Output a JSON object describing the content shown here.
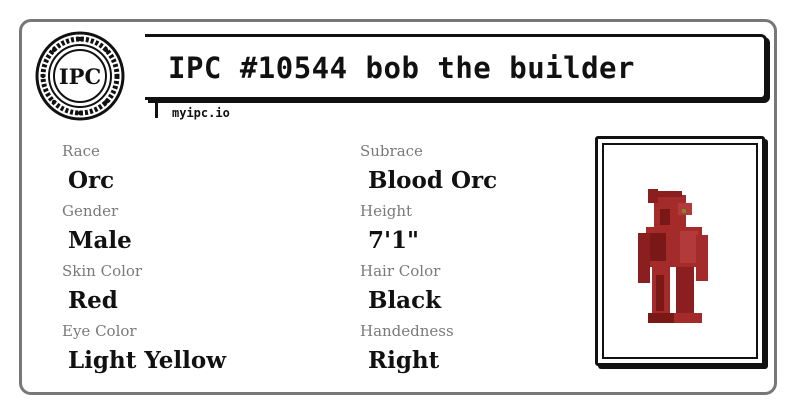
{
  "card": {
    "title": "IPC #10544 bob the builder",
    "subtitle": "myipc.io",
    "seal_text": "IPC",
    "colors": {
      "border": "#777777",
      "ink": "#111111",
      "label": "#7a7a7a",
      "skin": "#a52a2a"
    }
  },
  "attributes": [
    {
      "label": "Race",
      "value": "Orc"
    },
    {
      "label": "Subrace",
      "value": "Blood Orc"
    },
    {
      "label": "Gender",
      "value": "Male"
    },
    {
      "label": "Height",
      "value": "7'1\""
    },
    {
      "label": "Skin Color",
      "value": "Red"
    },
    {
      "label": "Hair Color",
      "value": "Black"
    },
    {
      "label": "Eye Color",
      "value": "Light Yellow"
    },
    {
      "label": "Handedness",
      "value": "Right"
    }
  ]
}
